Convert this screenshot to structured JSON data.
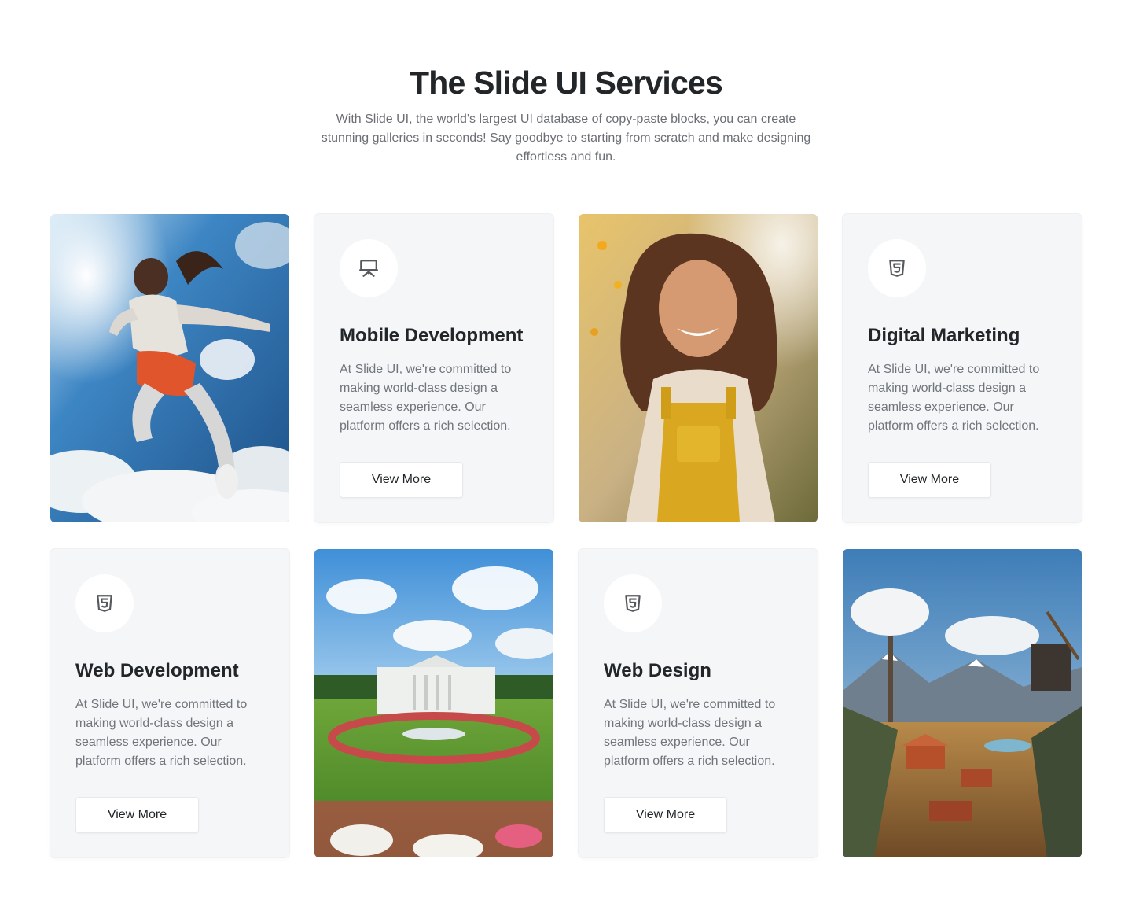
{
  "header": {
    "title": "The Slide UI Services",
    "subtitle": "With Slide UI, the world's largest UI database of copy-paste blocks, you can create stunning galleries in seconds! Say goodbye to starting from scratch and make designing effortless and fun."
  },
  "cards": [
    {
      "type": "image",
      "image": "woman-jumping-sky-photo"
    },
    {
      "type": "service",
      "icon": "presentation-board-icon",
      "title": "Mobile Development",
      "description": "At Slide UI, we're committed to making world-class design a seamless experience. Our platform offers a rich selection.",
      "button": "View More"
    },
    {
      "type": "image",
      "image": "smiling-woman-overalls-photo"
    },
    {
      "type": "service",
      "icon": "html5-icon",
      "title": "Digital Marketing",
      "description": "At Slide UI, we're committed to making world-class design a seamless experience. Our platform offers a rich selection.",
      "button": "View More"
    },
    {
      "type": "service",
      "icon": "html5-icon",
      "title": "Web Development",
      "description": "At Slide UI, we're committed to making world-class design a seamless experience. Our platform offers a rich selection.",
      "button": "View More"
    },
    {
      "type": "image",
      "image": "white-house-garden-photo"
    },
    {
      "type": "service",
      "icon": "html5-icon",
      "title": "Web Design",
      "description": "At Slide UI, we're committed to making world-class design a seamless experience. Our platform offers a rich selection.",
      "button": "View More"
    },
    {
      "type": "image",
      "image": "mining-landscape-photo"
    }
  ],
  "colors": {
    "background": "#ffffff",
    "card": "#f5f6f8",
    "heading": "#222629",
    "body_text": "#70757b",
    "icon": "#55595e"
  }
}
